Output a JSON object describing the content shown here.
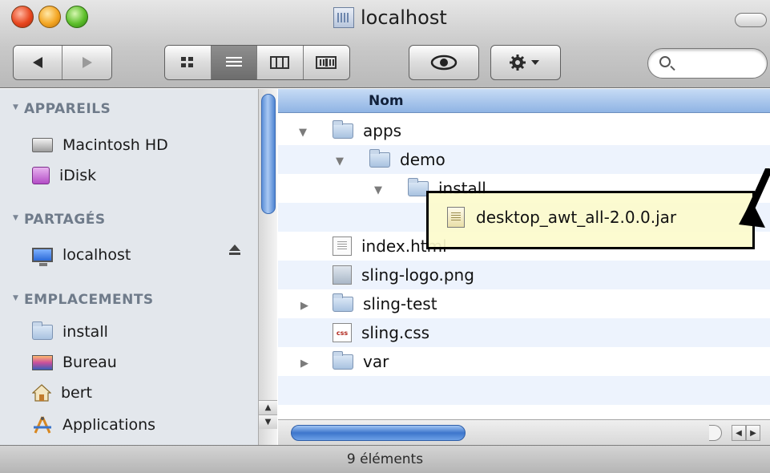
{
  "window": {
    "title": "localhost",
    "status": "9 éléments"
  },
  "toolbar": {
    "back_icon": "back-arrow-icon",
    "forward_icon": "forward-arrow-icon",
    "views": [
      "icon-view",
      "list-view",
      "column-view",
      "coverflow-view"
    ],
    "active_view": "list-view",
    "search_placeholder": ""
  },
  "sidebar": {
    "sections": [
      {
        "label": "APPAREILS",
        "items": [
          {
            "label": "Macintosh HD",
            "icon": "hard-drive-icon"
          },
          {
            "label": "iDisk",
            "icon": "idisk-icon"
          }
        ]
      },
      {
        "label": "PARTAGÉS",
        "items": [
          {
            "label": "localhost",
            "icon": "network-computer-icon"
          }
        ]
      },
      {
        "label": "EMPLACEMENTS",
        "items": [
          {
            "label": "install",
            "icon": "folder-icon"
          },
          {
            "label": "Bureau",
            "icon": "desktop-icon"
          },
          {
            "label": "bert",
            "icon": "home-icon"
          },
          {
            "label": "Applications",
            "icon": "applications-icon"
          }
        ]
      }
    ]
  },
  "list": {
    "column_header": "Nom",
    "rows": [
      {
        "name": "apps",
        "type": "folder",
        "expanded": true
      },
      {
        "name": "demo",
        "type": "folder",
        "expanded": true
      },
      {
        "name": "install",
        "type": "folder",
        "expanded": true
      },
      {
        "name": "desktop_awt_all-2.0.0.jar",
        "type": "jar"
      },
      {
        "name": "index.html",
        "type": "html"
      },
      {
        "name": "sling-logo.png",
        "type": "image"
      },
      {
        "name": "sling-test",
        "type": "folder",
        "expanded": false
      },
      {
        "name": "sling.css",
        "type": "css"
      },
      {
        "name": "var",
        "type": "folder",
        "expanded": false
      }
    ],
    "css_badge": "css"
  },
  "colors": {
    "selection_header": "#8fb4e4",
    "callout_fill": "#fcfbcc",
    "scroll_accent": "#3d76cc"
  }
}
